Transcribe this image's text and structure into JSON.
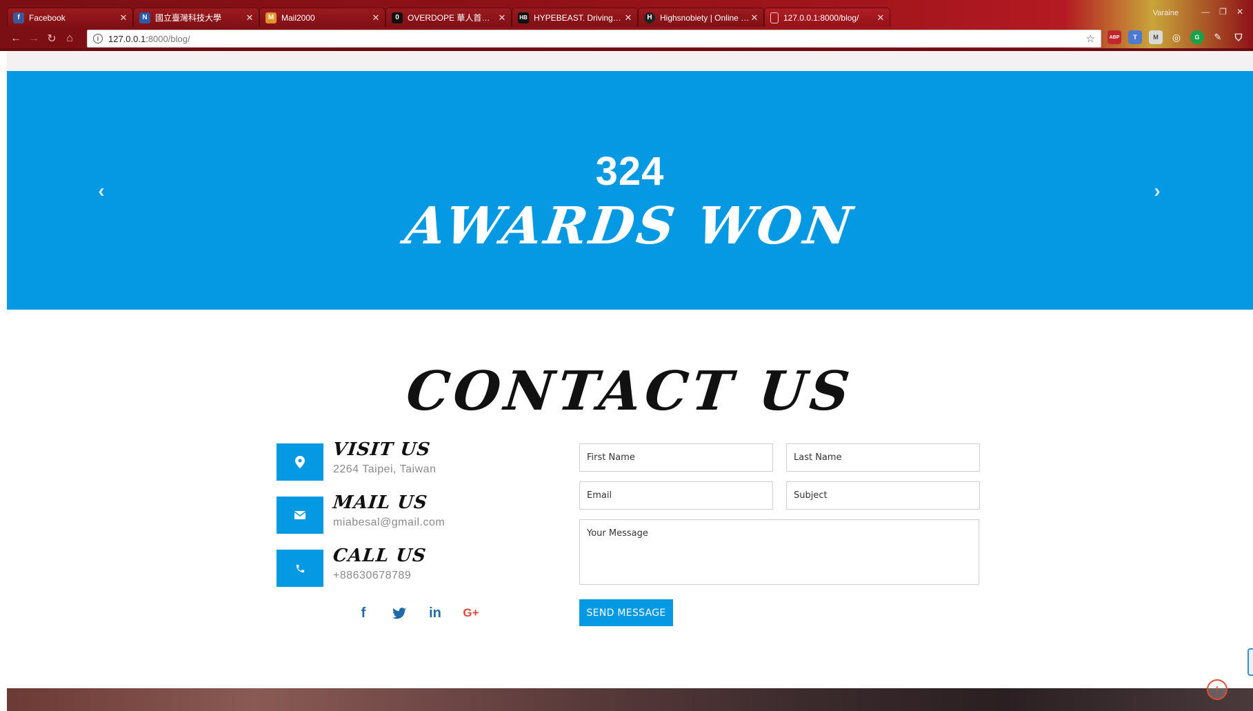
{
  "browser": {
    "tabs": [
      {
        "title": "Facebook",
        "favicon": "facebook-icon",
        "color": "#3b5998",
        "glyph": "f"
      },
      {
        "title": "國立臺灣科技大學",
        "favicon": "ntust-icon",
        "color": "#2b5aa8",
        "glyph": "N"
      },
      {
        "title": "Mail2000",
        "favicon": "mail2000-icon",
        "color": "#e2932b",
        "glyph": "M"
      },
      {
        "title": "OVERDOPE 華人首席線上",
        "favicon": "overdope-icon",
        "color": "#111111",
        "glyph": "0"
      },
      {
        "title": "HYPEBEAST. Driving Cult",
        "favicon": "hypebeast-icon",
        "color": "#111111",
        "glyph": "HB"
      },
      {
        "title": "Highsnobiety | Online life",
        "favicon": "highsnobiety-icon",
        "color": "#222222",
        "glyph": "H"
      },
      {
        "title": "127.0.0.1:8000/blog/",
        "favicon": "page-icon",
        "color": "#c04048",
        "glyph": "▯"
      }
    ],
    "active_tab": 6,
    "user_name": "Varaine",
    "url_host": "127.0.0.1:",
    "url_path": "8000/blog/",
    "extensions": [
      "ABP",
      "T",
      "M",
      "◎",
      "G",
      "✎",
      "⛉"
    ]
  },
  "hero": {
    "counter": "324",
    "counter_label": "AWARDS WON"
  },
  "contact": {
    "title": "CONTACT US",
    "items": [
      {
        "heading": "VISIT US",
        "value": "2264 Taipei, Taiwan",
        "icon": "map-marker-icon"
      },
      {
        "heading": "MAIL US",
        "value": "miabesal@gmail.com",
        "icon": "envelope-icon"
      },
      {
        "heading": "CALL US",
        "value": "+88630678789",
        "icon": "phone-icon"
      }
    ],
    "socials": [
      "f",
      "t",
      "in",
      "G+"
    ],
    "form": {
      "first_name_placeholder": "First Name",
      "last_name_placeholder": "Last Name",
      "email_placeholder": "Email",
      "subject_placeholder": "Subject",
      "message_placeholder": "Your Message",
      "send_label": "SEND MESSAGE"
    }
  },
  "colors": {
    "accent": "#0598e3",
    "chrome": "#8e1117"
  }
}
